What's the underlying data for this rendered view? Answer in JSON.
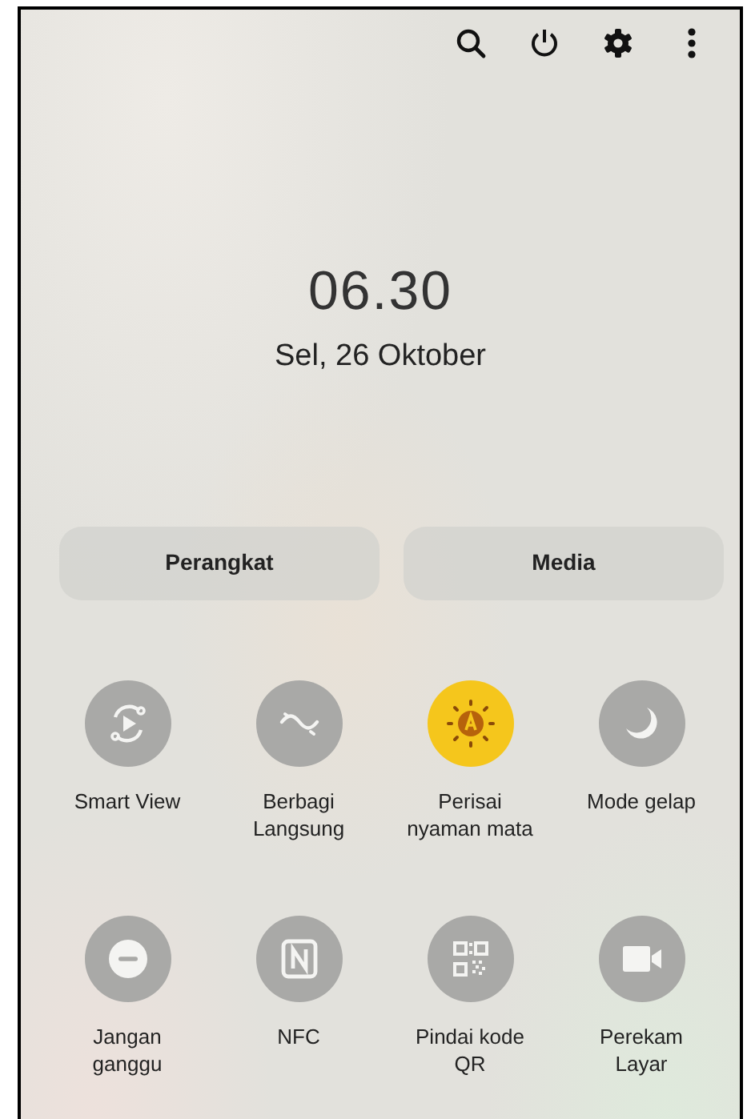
{
  "header_icons": [
    {
      "kind": "search"
    },
    {
      "kind": "power"
    },
    {
      "kind": "settings"
    },
    {
      "kind": "more"
    }
  ],
  "clock": {
    "time": "06.30",
    "date": "Sel, 26 Oktober"
  },
  "panel_buttons": [
    "Perangkat",
    "Media"
  ],
  "tiles": [
    {
      "kind": "smart-view",
      "label": "Smart View",
      "on": false
    },
    {
      "kind": "share",
      "label": "Berbagi Langsung",
      "on": false
    },
    {
      "kind": "eye-comfort",
      "label": "Perisai nyaman mata",
      "on": true
    },
    {
      "kind": "dark-mode",
      "label": "Mode gelap",
      "on": false
    },
    {
      "kind": "dnd",
      "label": "Jangan ganggu",
      "on": false
    },
    {
      "kind": "nfc",
      "label": "NFC",
      "on": false
    },
    {
      "kind": "qr",
      "label": "Pindai kode QR",
      "on": false
    },
    {
      "kind": "record",
      "label": "Perekam Layar",
      "on": false
    }
  ]
}
